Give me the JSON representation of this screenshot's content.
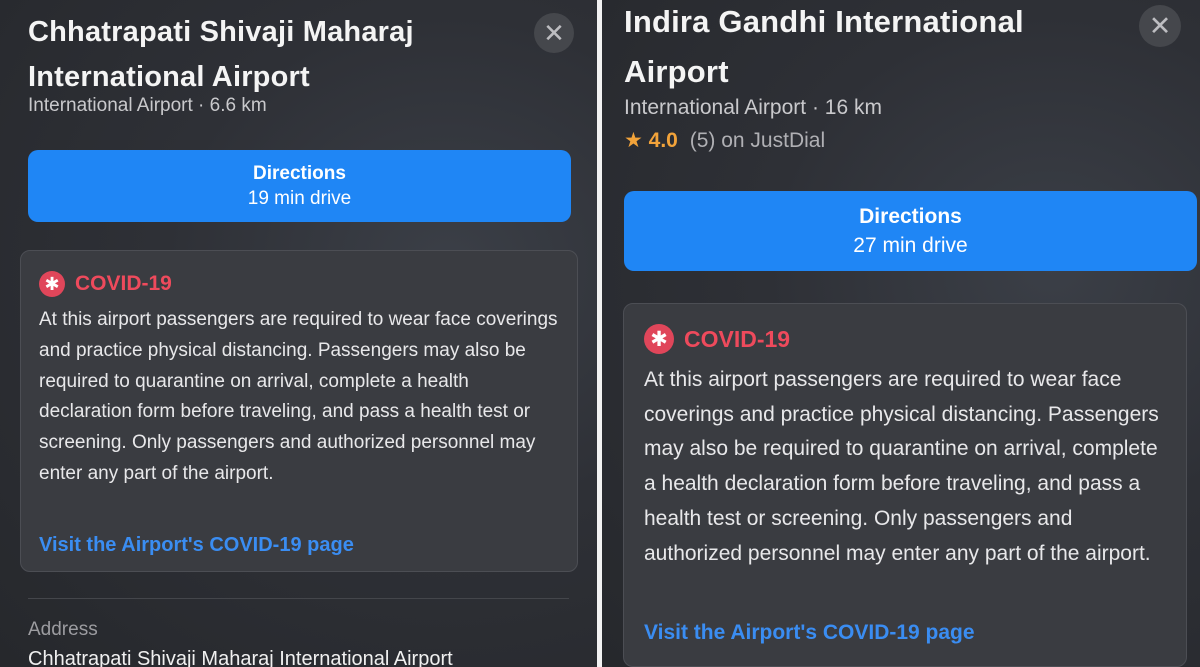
{
  "left": {
    "title": "Chhatrapati Shivaji Maharaj International Airport",
    "subtitle": "International Airport · 6.6 km",
    "close_icon": "close-icon",
    "directions": {
      "label": "Directions",
      "eta": "19 min drive"
    },
    "covid": {
      "icon": "covid-alert-icon",
      "title": "COVID-19",
      "body": "At this airport passengers are required to wear face coverings and practice physical distancing. Passengers may also be required to quarantine on arrival, complete a health declaration form before traveling, and pass a health test or screening. Only passengers and authorized personnel may enter any part of the airport.",
      "link": "Visit the Airport's COVID-19 page"
    },
    "address": {
      "label": "Address",
      "value": "Chhatrapati Shivaji Maharaj International Airport"
    }
  },
  "right": {
    "title": "Indira Gandhi International Airport",
    "subtitle": "International Airport · 16 km",
    "rating": {
      "star": "★",
      "score": "4.0",
      "count": "(5)",
      "source": "on JustDial"
    },
    "close_icon": "close-icon",
    "directions": {
      "label": "Directions",
      "eta": "27 min drive"
    },
    "covid": {
      "icon": "covid-alert-icon",
      "title": "COVID-19",
      "body": "At this airport passengers are required to wear face coverings and practice physical distancing. Passengers may also be required to quarantine on arrival, complete a health declaration form before traveling, and pass a health test or screening. Only passengers and authorized personnel may enter any part of the airport.",
      "link": "Visit the Airport's COVID-19 page"
    }
  },
  "colors": {
    "accent": "#1f86f5",
    "covid_red": "#ee4a5c",
    "link_blue": "#3a8df2",
    "star_orange": "#f2a33a",
    "panel_bg": "#2e3036"
  }
}
